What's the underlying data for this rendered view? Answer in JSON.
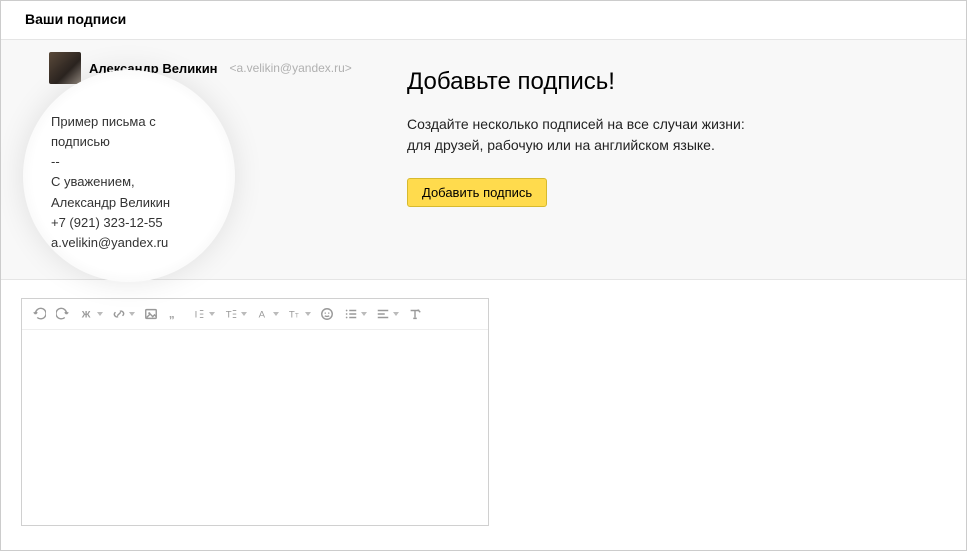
{
  "header": {
    "title": "Ваши подписи"
  },
  "preview": {
    "sender_name": "Александр Великин",
    "sender_email": "<a.velikin@yandex.ru>",
    "sample_intro": "Пример письма с подписью",
    "sig_sep": "--",
    "sig_line1": "С уважением,",
    "sig_line2": "Александр Великин",
    "sig_line3": "+7 (921) 323-12-55",
    "sig_line4": "a.velikin@yandex.ru"
  },
  "intro": {
    "title": "Добавьте подпись!",
    "text_line1": "Создайте несколько подписей на все случаи жизни:",
    "text_line2": "для друзей, рабочую или на английском языке.",
    "button": "Добавить подпись"
  },
  "toolbar": {
    "undo": "undo",
    "redo": "redo",
    "bold": "bold",
    "link": "link",
    "image": "image",
    "quote": "quote",
    "remove_format": "remove-format",
    "paragraph": "paragraph",
    "font_color": "font-color",
    "font_size": "font-size",
    "emoji": "emoji",
    "list": "list",
    "align": "align",
    "clear": "clear"
  }
}
